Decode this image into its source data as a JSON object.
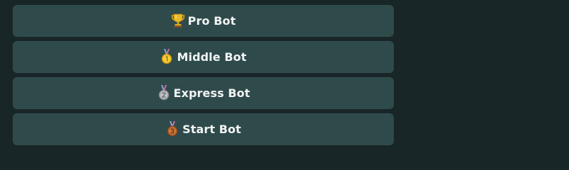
{
  "bots": [
    {
      "label": "Pro Bot",
      "icon": "trophy-icon"
    },
    {
      "label": "Middle Bot",
      "icon": "first-place-medal-icon"
    },
    {
      "label": "Express Bot",
      "icon": "second-place-medal-icon"
    },
    {
      "label": "Start Bot",
      "icon": "third-place-medal-icon"
    }
  ],
  "colors": {
    "background": "#182628",
    "button": "#2f4a4b",
    "text": "#f1f4f3",
    "gold": "#e9b928",
    "silver": "#a9adb0",
    "bronze": "#b5652f"
  }
}
